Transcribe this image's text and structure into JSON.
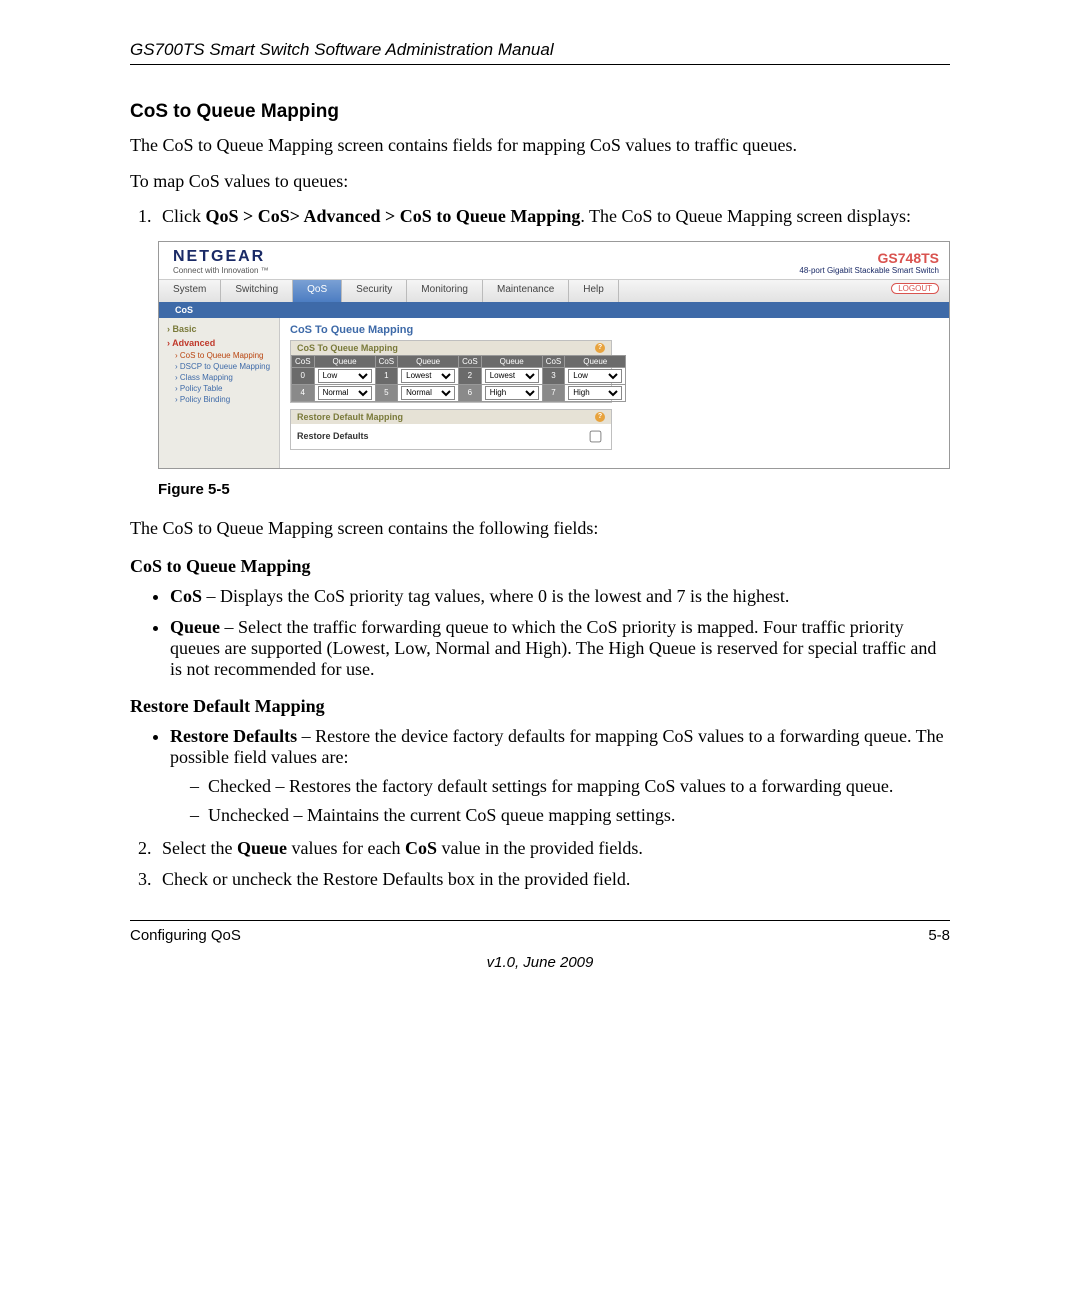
{
  "doc": {
    "header": "GS700TS Smart Switch Software Administration Manual",
    "section_title": "CoS to Queue Mapping",
    "intro1": "The CoS to Queue Mapping screen contains fields for mapping CoS values to traffic queues.",
    "intro2": "To map CoS values to queues:",
    "step1_pre": "Click ",
    "step1_path": "QoS > CoS> Advanced > CoS to Queue Mapping",
    "step1_post": ". The CoS to Queue Mapping screen displays:",
    "figure_caption": "Figure 5-5",
    "after_figure": "The CoS to Queue Mapping screen contains the following fields:",
    "sub1": "CoS to Queue Mapping",
    "bullet_cos_label": "CoS",
    "bullet_cos_text": " – Displays the CoS priority tag values, where 0 is the lowest and 7 is the highest.",
    "bullet_queue_label": "Queue",
    "bullet_queue_text": " – Select the traffic forwarding queue to which the CoS priority is mapped. Four traffic priority queues are supported (Lowest, Low, Normal and High). The High Queue is reserved for special traffic and is not recommended for use.",
    "sub2": "Restore Default Mapping",
    "bullet_rd_label": "Restore Defaults",
    "bullet_rd_text": " – Restore the device factory defaults for mapping CoS values to a forwarding queue. The possible field values are:",
    "dash_checked": "Checked – Restores the factory default settings for mapping CoS values to a forwarding queue.",
    "dash_unchecked": "Unchecked – Maintains the current CoS queue mapping settings.",
    "step2_pre": "Select the ",
    "step2_b1": "Queue",
    "step2_mid": " values for each ",
    "step2_b2": "CoS",
    "step2_post": " value in the provided fields.",
    "step3": "Check or uncheck the Restore Defaults box in the provided field.",
    "footer_left": "Configuring QoS",
    "footer_right": "5-8",
    "footer_center": "v1.0, June 2009"
  },
  "ss": {
    "brand": "NETGEAR",
    "brand_sub": "Connect with Innovation ™",
    "product": "GS748TS",
    "product_sub": "48-port Gigabit Stackable Smart Switch",
    "tabs": [
      "System",
      "Switching",
      "QoS",
      "Security",
      "Monitoring",
      "Maintenance",
      "Help"
    ],
    "active_tab": "QoS",
    "logout": "LOGOUT",
    "subtab": "CoS",
    "sidebar": {
      "basic": "Basic",
      "advanced": "Advanced",
      "items": [
        "CoS to Queue Mapping",
        "DSCP to Queue Mapping",
        "Class Mapping",
        "Policy Table",
        "Policy Binding"
      ]
    },
    "main_title": "CoS To Queue Mapping",
    "panel1_title": "CoS To Queue Mapping",
    "cos_label": "CoS",
    "queue_label": "Queue",
    "mappings": [
      {
        "cos": "0",
        "queue": "Low"
      },
      {
        "cos": "1",
        "queue": "Lowest"
      },
      {
        "cos": "2",
        "queue": "Lowest"
      },
      {
        "cos": "3",
        "queue": "Low"
      },
      {
        "cos": "4",
        "queue": "Normal"
      },
      {
        "cos": "5",
        "queue": "Normal"
      },
      {
        "cos": "6",
        "queue": "High"
      },
      {
        "cos": "7",
        "queue": "High"
      }
    ],
    "panel2_title": "Restore Default Mapping",
    "restore_label": "Restore Defaults",
    "help_icon": "?"
  }
}
